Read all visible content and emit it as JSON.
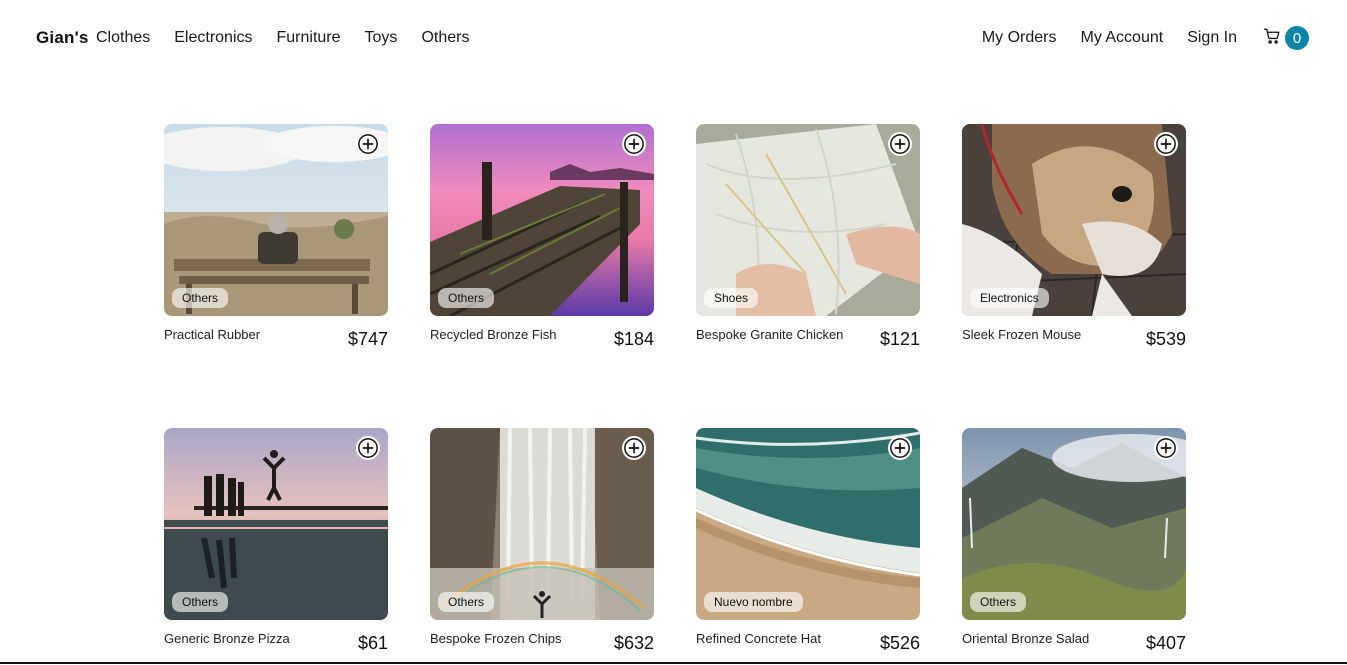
{
  "brand": "Gian's",
  "nav_left": [
    "Clothes",
    "Electronics",
    "Furniture",
    "Toys",
    "Others"
  ],
  "nav_right": [
    "My Orders",
    "My Account",
    "Sign In"
  ],
  "cart": {
    "icon": "cart-icon",
    "count": "0",
    "badge_color": "#0b86a8"
  },
  "products": [
    {
      "name": "Practical Rubber",
      "price": "$747",
      "category": "Others",
      "scene": "bench-by-sea"
    },
    {
      "name": "Recycled Bronze Fish",
      "price": "$184",
      "category": "Others",
      "scene": "pier-sunset"
    },
    {
      "name": "Bespoke Granite Chicken",
      "price": "$121",
      "category": "Shoes",
      "scene": "hands-with-map"
    },
    {
      "name": "Sleek Frozen Mouse",
      "price": "$539",
      "category": "Electronics",
      "scene": "bulldog"
    },
    {
      "name": "Generic Bronze Pizza",
      "price": "$61",
      "category": "Others",
      "scene": "people-jumping-at-sunset"
    },
    {
      "name": "Bespoke Frozen Chips",
      "price": "$632",
      "category": "Others",
      "scene": "waterfall-with-rainbow"
    },
    {
      "name": "Refined Concrete Hat",
      "price": "$526",
      "category": "Nuevo nombre",
      "scene": "beach-waves"
    },
    {
      "name": "Oriental Bronze Salad",
      "price": "$407",
      "category": "Others",
      "scene": "misty-mountains"
    }
  ]
}
